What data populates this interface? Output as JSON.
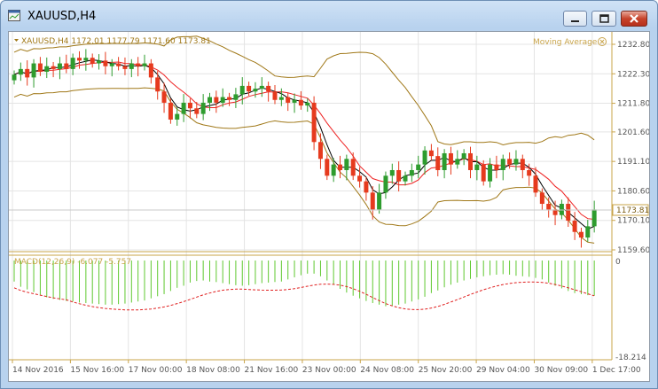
{
  "window": {
    "title": "XAUUSD,H4",
    "icon_name": "chart-window-icon",
    "buttons": [
      "minimize-icon",
      "restore-icon",
      "close-icon"
    ]
  },
  "chart_header": {
    "text": "XAUUSD,H4  1172.01 1177.79 1171.60 1173.81",
    "indicator_label": "Moving Average"
  },
  "macd": {
    "label": "MACD(12,26,9) -6.077 -5.757",
    "top_label": "0",
    "bottom_label": "-18.214"
  },
  "colors": {
    "bull": "#2e9c2e",
    "bear": "#e63a1e",
    "bands": "#a07818",
    "ma_fast": "#000000",
    "ma_slow": "#ee2222",
    "macd_bars": "#5fc82f",
    "macd_signal": "#e02020",
    "axis": "#c9a44a",
    "grid": "#e4e4e4"
  },
  "chart_data": {
    "type": "candlestick",
    "symbol": "XAUUSD",
    "timeframe": "H4",
    "ohlc": [
      1172.01,
      1177.79,
      1171.6,
      1173.81
    ],
    "current_price": "1173.81",
    "price_axis": [
      "1232.80",
      "1222.30",
      "1211.80",
      "1201.60",
      "1191.10",
      "1180.60",
      "1170.10",
      "1159.60"
    ],
    "price_range": [
      1159.6,
      1232.8
    ],
    "time_axis": [
      "14 Nov 2016",
      "15 Nov 16:00",
      "17 Nov 00:00",
      "18 Nov 08:00",
      "21 Nov 16:00",
      "23 Nov 00:00",
      "24 Nov 08:00",
      "25 Nov 20:00",
      "29 Nov 04:00",
      "30 Nov 09:00",
      "1 Dec 17:00"
    ],
    "close_path": [
      1222,
      1224,
      1221,
      1226,
      1223,
      1225,
      1224,
      1226,
      1224,
      1228,
      1227,
      1228,
      1226,
      1227,
      1225,
      1226,
      1225,
      1224,
      1226,
      1225,
      1226,
      1221,
      1216,
      1212,
      1206,
      1208,
      1212,
      1210,
      1208,
      1212,
      1214,
      1212,
      1214,
      1213,
      1215,
      1218,
      1216,
      1217,
      1218,
      1216,
      1213,
      1214,
      1212,
      1213,
      1211,
      1212,
      1198,
      1192,
      1186,
      1190,
      1188,
      1192,
      1186,
      1184,
      1180,
      1174,
      1180,
      1186,
      1188,
      1184,
      1186,
      1188,
      1190,
      1195,
      1193,
      1188,
      1194,
      1190,
      1192,
      1194,
      1188,
      1190,
      1184,
      1190,
      1188,
      1192,
      1190,
      1192,
      1188,
      1186,
      1180,
      1176,
      1174,
      1172,
      1176,
      1170,
      1166,
      1164,
      1168,
      1174
    ],
    "macd_hist": [
      -4,
      -5,
      -5.5,
      -6,
      -6.5,
      -7,
      -7.3,
      -7.5,
      -7.7,
      -7.8,
      -8,
      -8.1,
      -8.2,
      -8.3,
      -8.4,
      -8.4,
      -8.3,
      -8.2,
      -8,
      -7.8,
      -7.6,
      -7.2,
      -6.8,
      -6.4,
      -5.8,
      -5.2,
      -4.8,
      -4.2,
      -3.9,
      -3.8,
      -4,
      -4.1,
      -4.3,
      -4.5,
      -4.7,
      -4.8,
      -4.7,
      -4.5,
      -4.3,
      -4.2,
      -4.1,
      -4,
      -3.6,
      -3.2,
      -2.8,
      -2.5,
      -2.5,
      -3,
      -3.8,
      -4.6,
      -5.4,
      -6.1,
      -6.7,
      -7.2,
      -7.7,
      -8.1,
      -8.4,
      -8.7,
      -8.6,
      -8.4,
      -8.2,
      -7.8,
      -7.4,
      -6.9,
      -6.2,
      -5.7,
      -5.1,
      -4.6,
      -4.2,
      -3.8,
      -3.5,
      -3.2,
      -3,
      -2.8,
      -2.7,
      -2.6,
      -2.7,
      -2.9,
      -3,
      -3.1,
      -3.3,
      -3.6,
      -4.2,
      -4.8,
      -5.3,
      -5.8,
      -6.2,
      -6.4,
      -6.6,
      -6.7
    ]
  }
}
